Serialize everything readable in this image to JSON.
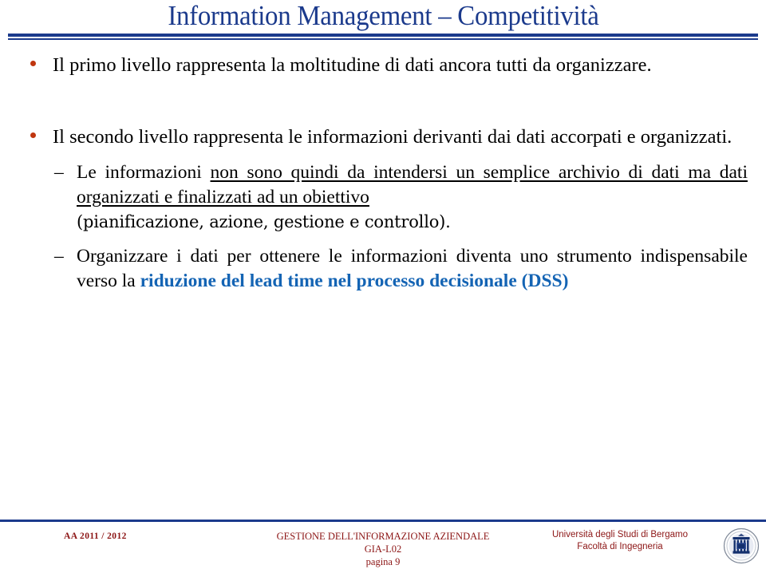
{
  "slide": {
    "title": "Information Management – Competitività",
    "title_color": "#1b3a8c",
    "rule_color": "#1b3a8c",
    "bullet_color": "#c0360f",
    "accent_blue": "#1464b4",
    "footer_color": "#8c1515"
  },
  "body": {
    "bullet1": {
      "marker": "bullet-dot",
      "text": "Il primo livello rappresenta la moltitudine di dati ancora tutti da organizzare."
    },
    "bullet2": {
      "marker": "bullet-dot",
      "text": "Il secondo livello rappresenta le informazioni derivanti dai dati accorpati e organizzati."
    },
    "sub1": {
      "marker": "–",
      "plain_lead": "Le informazioni ",
      "underlined": "non sono quindi da intendersi un semplice archivio di dati ma dati organizzati e finalizzati ad un obiettivo",
      "tail": "(pianificazione, azione, gestione e controllo)."
    },
    "sub2": {
      "marker": "–",
      "plain_lead": "Organizzare i dati per ottenere le informazioni diventa uno strumento indispensabile verso la ",
      "highlight": "riduzione del lead time nel processo decisionale (DSS)"
    }
  },
  "footer": {
    "academic_year": "AA  2011 / 2012",
    "course_name": "GESTIONE DELL'INFORMAZIONE AZIENDALE",
    "course_code": "GIA-L02",
    "page_label": "pagina 9",
    "university_line1": "Università degli Studi di Bergamo",
    "university_line2": "Facoltà  di Ingegneria",
    "seal_icon": "university-seal-icon"
  }
}
